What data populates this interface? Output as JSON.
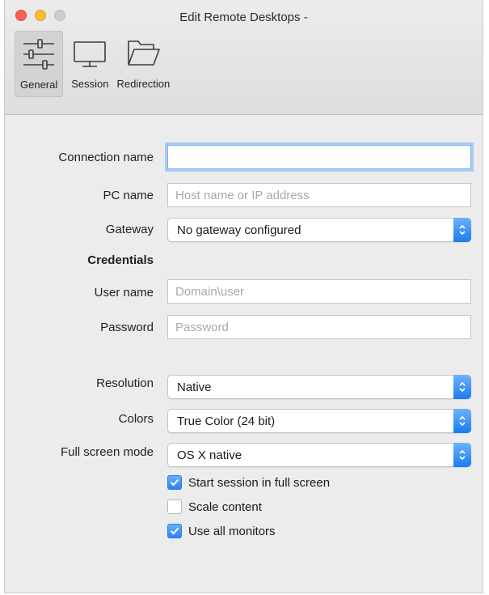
{
  "window": {
    "title": "Edit Remote Desktops -"
  },
  "toolbar": {
    "items": [
      {
        "label": "General",
        "icon": "sliders-icon",
        "active": true
      },
      {
        "label": "Session",
        "icon": "monitor-icon",
        "active": false
      },
      {
        "label": "Redirection",
        "icon": "folder-icon",
        "active": false
      }
    ]
  },
  "form": {
    "connection_name": {
      "label": "Connection name",
      "value": ""
    },
    "pc_name": {
      "label": "PC name",
      "placeholder": "Host name or IP address"
    },
    "gateway": {
      "label": "Gateway",
      "value": "No gateway configured"
    },
    "credentials": {
      "heading": "Credentials"
    },
    "user_name": {
      "label": "User name",
      "placeholder": "Domain\\user"
    },
    "password": {
      "label": "Password",
      "placeholder": "Password"
    },
    "resolution": {
      "label": "Resolution",
      "value": "Native"
    },
    "colors": {
      "label": "Colors",
      "value": "True Color (24 bit)"
    },
    "full_screen_mode": {
      "label": "Full screen mode",
      "value": "OS X native"
    },
    "options": [
      {
        "label": "Start session in full screen",
        "checked": true
      },
      {
        "label": "Scale content",
        "checked": false
      },
      {
        "label": "Use all monitors",
        "checked": true
      }
    ]
  },
  "colors": {
    "accent": "#1a7bf0",
    "focus_ring": "#a9cbf4"
  }
}
